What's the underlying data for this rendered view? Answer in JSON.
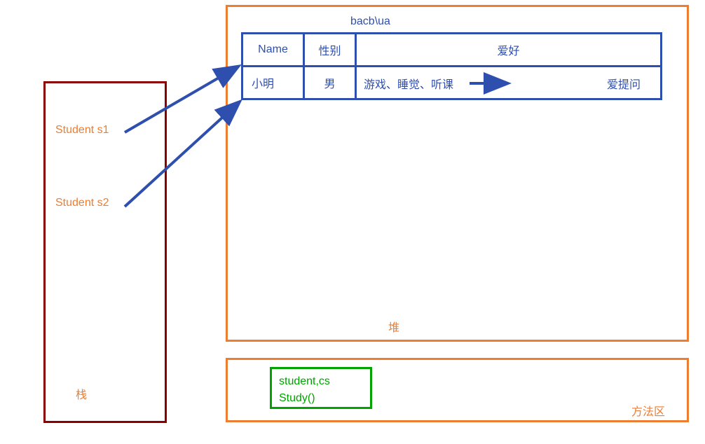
{
  "stack": {
    "label": "栈",
    "items": [
      {
        "label": "Student s1"
      },
      {
        "label": "Student s2"
      }
    ]
  },
  "heap": {
    "label": "堆",
    "address": "bacb\\ua",
    "table": {
      "headers": [
        "Name",
        "性别",
        "爱好"
      ],
      "row": {
        "name": "小明",
        "gender": "男",
        "hobby_left": "游戏、睡觉、听课",
        "hobby_right": "爱提问"
      }
    }
  },
  "method_area": {
    "label": "方法区",
    "content_line1": "student,cs",
    "content_line2": "Study()"
  },
  "colors": {
    "orange": "#ed7d31",
    "darkred": "#8b0000",
    "blue": "#2e4fae",
    "green": "#00a300"
  }
}
